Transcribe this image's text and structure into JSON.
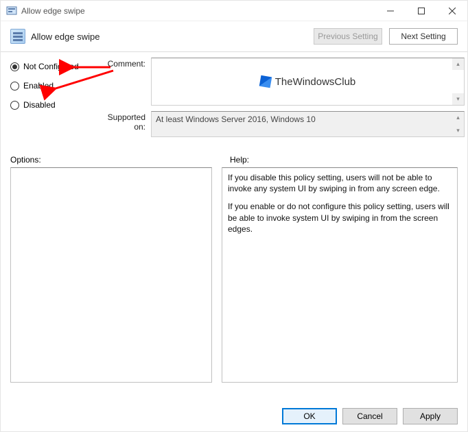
{
  "window": {
    "title": "Allow edge swipe"
  },
  "header": {
    "title": "Allow edge swipe",
    "prev_button_label": "Previous Setting",
    "next_button_label": "Next Setting"
  },
  "config": {
    "radios": {
      "not_configured": "Not Configured",
      "enabled": "Enabled",
      "disabled": "Disabled",
      "selected": "not_configured"
    },
    "comment_label": "Comment:",
    "supported_label": "Supported on:",
    "supported_text": "At least Windows Server 2016, Windows 10",
    "logo_text": "TheWindowsClub"
  },
  "panels": {
    "options_label": "Options:",
    "help_label": "Help:",
    "help_text": {
      "p1": "If you disable this policy setting, users will not be able to invoke any system UI by swiping in from any screen edge.",
      "p2": "If you enable or do not configure this policy setting, users will be able to invoke system UI by swiping in from the screen edges."
    }
  },
  "buttons": {
    "ok": "OK",
    "cancel": "Cancel",
    "apply": "Apply"
  }
}
